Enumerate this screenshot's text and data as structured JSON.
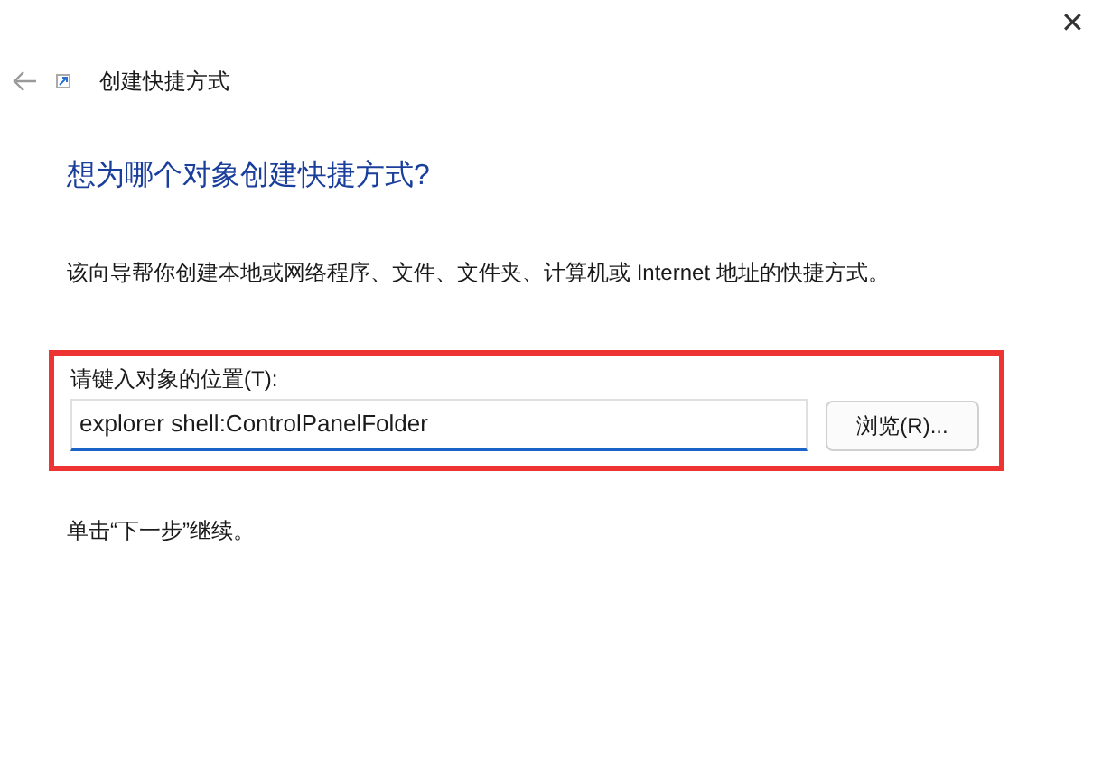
{
  "window": {
    "close": "✕",
    "title": "创建快捷方式"
  },
  "heading": "想为哪个对象创建快捷方式?",
  "description": "该向导帮你创建本地或网络程序、文件、文件夹、计算机或 Internet 地址的快捷方式。",
  "location": {
    "label": "请键入对象的位置(T):",
    "value": "explorer shell:ControlPanelFolder",
    "browse": "浏览(R)...",
    "highlighted": true
  },
  "hint": "单击“下一步”继续。"
}
